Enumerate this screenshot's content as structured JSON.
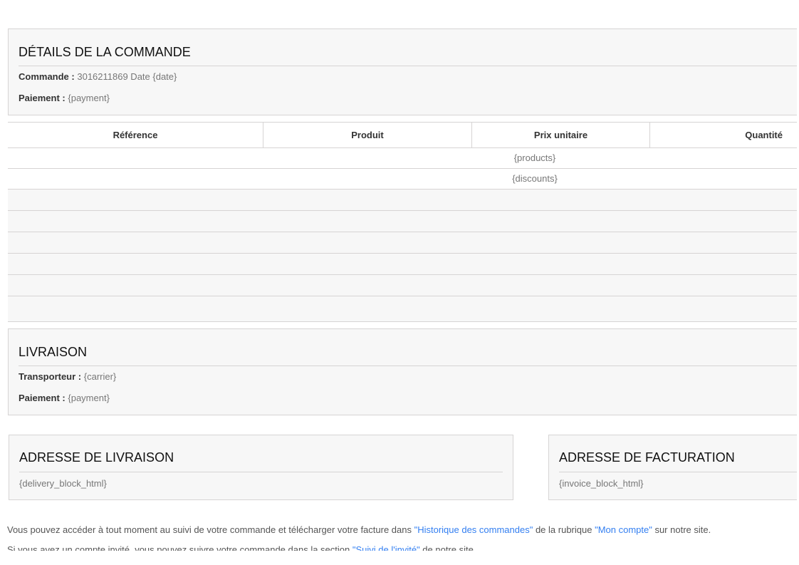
{
  "order": {
    "title": "DÉTAILS DE LA COMMANDE",
    "order_label": "Commande :",
    "order_value": "3016211869 Date {date}",
    "payment_label": "Paiement :",
    "payment_value": "{payment}"
  },
  "table": {
    "columns": [
      "Référence",
      "Produit",
      "Prix unitaire",
      "Quantité"
    ],
    "rows": [
      "{products}",
      "{discounts}"
    ]
  },
  "shipping": {
    "title": "LIVRAISON",
    "carrier_label": "Transporteur :",
    "carrier_value": "{carrier}",
    "payment_label": "Paiement :",
    "payment_value": "{payment}"
  },
  "delivery_address": {
    "title": "ADRESSE DE LIVRAISON",
    "value": "{delivery_block_html}"
  },
  "invoice_address": {
    "title": "ADRESSE DE FACTURATION",
    "value": "{invoice_block_html}"
  },
  "footer": {
    "line1_start": "Vous pouvez accéder à tout moment au suivi de votre commande et télécharger votre facture dans ",
    "history_link": "\"Historique des commandes\"",
    "line1_mid": " de la rubrique ",
    "account_link": "\"Mon compte\"",
    "line1_end": " sur notre site.",
    "line2_start": "Si vous avez un compte invité, vous pouvez suivre votre commande dans la section ",
    "guest_link": "\"Suivi de l'invité\"",
    "line2_end": " de notre site."
  },
  "colors": {
    "link": "#337ff1",
    "panel": "#f7f7f7",
    "border": "#d6d4d4"
  }
}
